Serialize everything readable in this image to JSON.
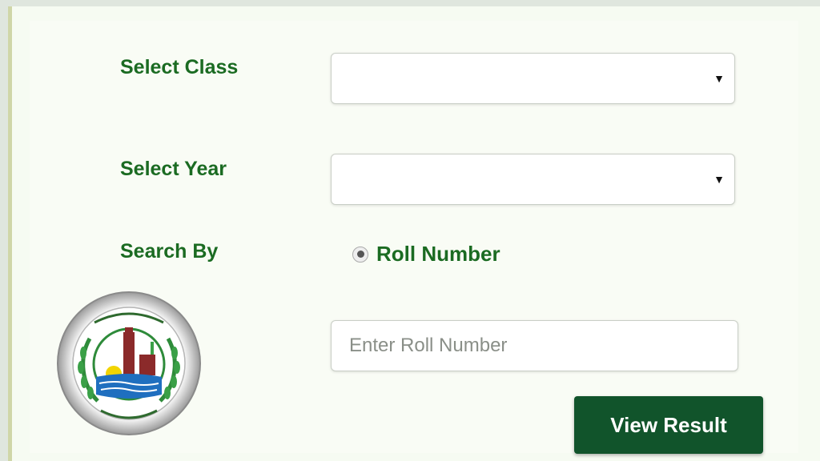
{
  "form": {
    "select_class_label": "Select Class",
    "select_year_label": "Select Year",
    "search_by_label": "Search By",
    "class_value": "",
    "year_value": "",
    "radio_option_label": "Roll Number",
    "roll_placeholder": "Enter Roll Number",
    "roll_value": "",
    "submit_label": "View Result"
  },
  "icons": {
    "dropdown": "chevron-down-icon",
    "logo": "board-seal-logo"
  },
  "colors": {
    "label_green": "#1b6b22",
    "button_bg": "#11542b",
    "page_bg": "#f6fbf2"
  }
}
